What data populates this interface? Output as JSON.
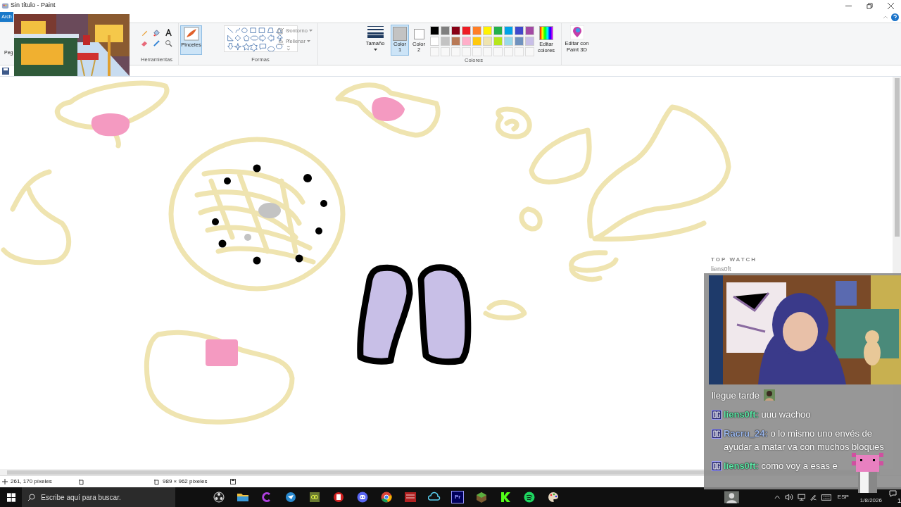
{
  "window": {
    "title": "Sin título - Paint"
  },
  "ribbon": {
    "file_tab": "Arch",
    "paste_label": "Peg",
    "tools_group": "Herramientas",
    "brushes_button": "Pinceles",
    "shapes_group": "Formas",
    "outline": "Contorno",
    "fill": "Rellenar",
    "size": "Tamaño",
    "color_slots": [
      {
        "label": "Color",
        "number": "1",
        "color": "#c3c3c3",
        "selected": true
      },
      {
        "label": "Color",
        "number": "2",
        "color": "#ffffff",
        "selected": false
      }
    ],
    "palette": [
      {
        "color": "#000000"
      },
      {
        "color": "#7f7f7f"
      },
      {
        "color": "#880015"
      },
      {
        "color": "#ed1c24"
      },
      {
        "color": "#ff7f27"
      },
      {
        "color": "#fff200"
      },
      {
        "color": "#22b14c"
      },
      {
        "color": "#00a2e8"
      },
      {
        "color": "#3f48cc"
      },
      {
        "color": "#a349a4"
      },
      {
        "color": "#ffffff"
      },
      {
        "color": "#c3c3c3"
      },
      {
        "color": "#b97a57"
      },
      {
        "color": "#ffaec9"
      },
      {
        "color": "#ffc90e"
      },
      {
        "color": "#efe4b0"
      },
      {
        "color": "#b5e61d"
      },
      {
        "color": "#99d9ea"
      },
      {
        "color": "#7092be"
      },
      {
        "color": "#c8bfe7"
      }
    ],
    "colors_group": "Colores",
    "edit_colors": "Editar colores",
    "paint3d": "Editar con Paint 3D"
  },
  "status_bar": {
    "cursor": "261, 170 píxeles",
    "size": "989 × 962 píxeles"
  },
  "taskbar": {
    "search_placeholder": "Escribe aquí para buscar.",
    "premiere_label": "Pr",
    "language": "ESP",
    "date": "1/8/2026",
    "notifications": "1"
  },
  "stream_overlay": {
    "top_watch_title": "TOP WATCH",
    "top_watch_name": "liens0ft",
    "chat": [
      {
        "kind": "continuation",
        "text": "llegue tarde",
        "emote": true
      },
      {
        "kind": "message",
        "user": "liens0ft:",
        "color": "#5ee8a8",
        "text": "uuu wachoo"
      },
      {
        "kind": "message",
        "user": "Racru_24:",
        "color": "#9cb8ec",
        "text": "o lo mismo uno envés de ayudar a matar va con muchos bloques"
      },
      {
        "kind": "message",
        "user": "liens0ft:",
        "color": "#5ee8a8",
        "text": "como voy a esas e"
      }
    ]
  }
}
